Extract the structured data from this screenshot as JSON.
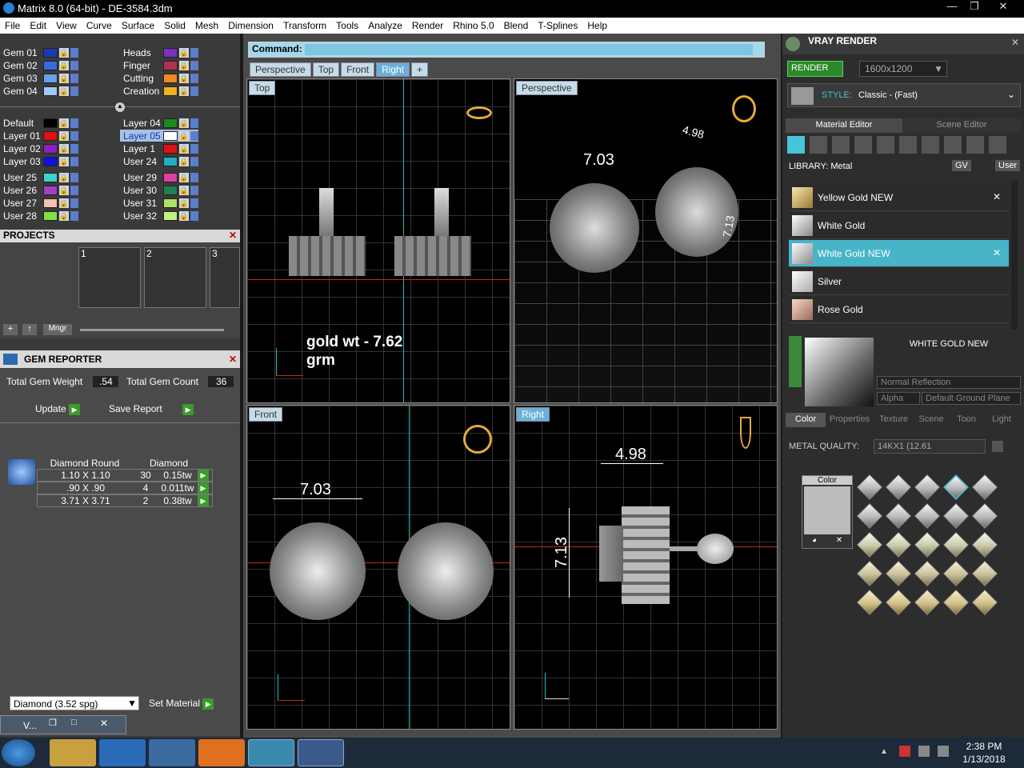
{
  "window": {
    "title": "Matrix 8.0 (64-bit) - DE-3584.3dm"
  },
  "menu": [
    "File",
    "Edit",
    "View",
    "Curve",
    "Surface",
    "Solid",
    "Mesh",
    "Dimension",
    "Transform",
    "Tools",
    "Analyze",
    "Render",
    "Rhino 5.0",
    "Blend",
    "T-Splines",
    "Help"
  ],
  "layers_top": [
    {
      "a": "Gem 01",
      "b": "Heads"
    },
    {
      "a": "Gem 02",
      "b": "Finger"
    },
    {
      "a": "Gem 03",
      "b": "Cutting"
    },
    {
      "a": "Gem 04",
      "b": "Creation"
    }
  ],
  "layers_mid": [
    {
      "a": "Default",
      "b": "Layer 04"
    },
    {
      "a": "Layer 01",
      "b": "Layer 05"
    },
    {
      "a": "Layer 02",
      "b": "Layer 1"
    },
    {
      "a": "Layer 03",
      "b": "User 24"
    }
  ],
  "layers_user": [
    {
      "a": "User 25",
      "b": "User 29"
    },
    {
      "a": "User 26",
      "b": "User 30"
    },
    {
      "a": "User 27",
      "b": "User 31"
    },
    {
      "a": "User 28",
      "b": "User 32"
    }
  ],
  "projects": {
    "title": "PROJECTS",
    "slots": [
      "1",
      "2",
      "3"
    ],
    "mngr": "Mngr"
  },
  "gem_reporter": {
    "title": "GEM REPORTER",
    "total_weight_label": "Total Gem Weight",
    "total_weight": ".54",
    "total_count_label": "Total Gem Count",
    "total_count": "36",
    "update": "Update",
    "save_report": "Save Report",
    "col1": "Diamond Round",
    "col2": "Diamond",
    "rows": [
      {
        "size": "1.10 X 1.10",
        "count": "30",
        "tw": "0.15tw"
      },
      {
        "size": ".90 X .90",
        "count": "4",
        "tw": "0.011tw"
      },
      {
        "size": "3.71 X 3.71",
        "count": "2",
        "tw": "0.38tw"
      }
    ],
    "material_select": "Diamond    (3.52 spg)",
    "set_material": "Set Material"
  },
  "minimized": {
    "label": "V..."
  },
  "command": {
    "label": "Command:",
    "value": ""
  },
  "view_tabs": [
    "Perspective",
    "Top",
    "Front",
    "Right"
  ],
  "viewports": {
    "top": {
      "label": "Top",
      "note1": "gold wt -  7.62",
      "note2": "grm"
    },
    "perspective": {
      "label": "Perspective",
      "dim1": "7.03",
      "dim2": "4.98",
      "dim3": "7.13"
    },
    "front": {
      "label": "Front",
      "dim1": "7.03"
    },
    "right": {
      "label": "Right",
      "dim1": "4.98",
      "dim2": "7.13"
    }
  },
  "vray": {
    "title": "VRAY RENDER",
    "render": "RENDER",
    "resolution": "1600x1200",
    "style_label": "STYLE:",
    "style": "Classic - (Fast)",
    "tab_material": "Material Editor",
    "tab_scene": "Scene Editor",
    "library": "LIBRARY: Metal",
    "gv": "GV",
    "user": "User",
    "materials": [
      "Yellow Gold NEW",
      "White Gold",
      "White Gold NEW",
      "Silver",
      "Rose Gold"
    ],
    "selected_material": "WHITE GOLD NEW",
    "reflection": "Normal Reflection",
    "alpha": "Alpha",
    "ground": "Default Ground Plane",
    "subtabs": [
      "Color",
      "Properties",
      "Texture",
      "Scene",
      "Toon",
      "Light"
    ],
    "metal_quality_label": "METAL QUALITY:",
    "metal_quality": "14KX1      (12.61",
    "color_label": "Color"
  },
  "clock": {
    "time": "2:38 PM",
    "date": "1/13/2018"
  }
}
